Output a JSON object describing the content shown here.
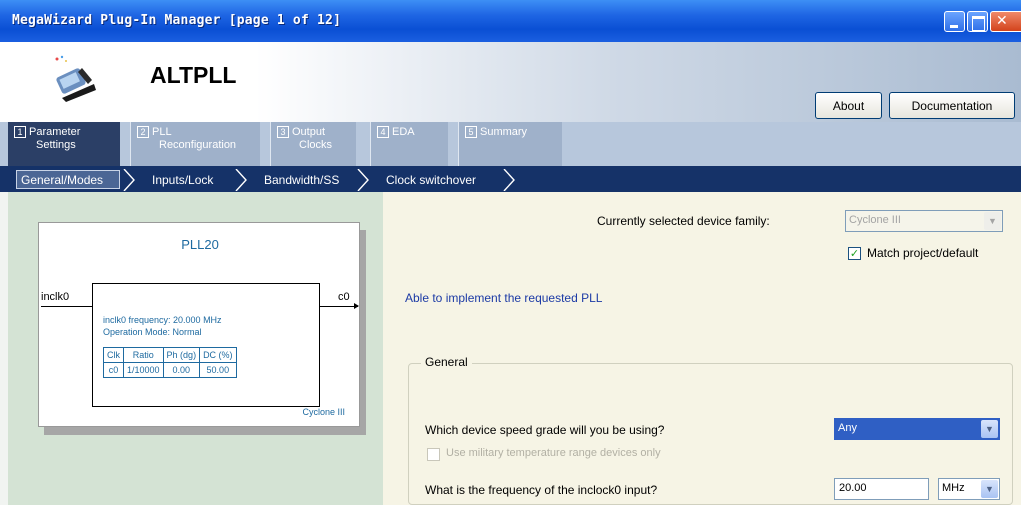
{
  "window": {
    "title": "MegaWizard Plug-In Manager [page 1 of 12]"
  },
  "header": {
    "app_name": "ALTPLL",
    "about_label": "About",
    "documentation_label": "Documentation"
  },
  "tabs": [
    {
      "num": "1",
      "line1": "Parameter",
      "line2": "Settings"
    },
    {
      "num": "2",
      "line1": "PLL",
      "line2": "Reconfiguration"
    },
    {
      "num": "3",
      "line1": "Output",
      "line2": "Clocks"
    },
    {
      "num": "4",
      "line1": "EDA",
      "line2": ""
    },
    {
      "num": "5",
      "line1": "Summary",
      "line2": ""
    }
  ],
  "subtabs": [
    "General/Modes",
    "Inputs/Lock",
    "Bandwidth/SS",
    "Clock switchover"
  ],
  "diagram": {
    "title": "PLL20",
    "input_port": "inclk0",
    "output_port": "c0",
    "frequency_line": "inclk0 frequency: 20.000 MHz",
    "mode_line": "Operation Mode: Normal",
    "table_headers": [
      "Clk",
      "Ratio",
      "Ph (dg)",
      "DC (%)"
    ],
    "table_rows": [
      [
        "c0",
        "1/10000",
        "0.00",
        "50.00"
      ]
    ],
    "family": "Cyclone III"
  },
  "settings": {
    "device_family_label": "Currently selected device family:",
    "device_family_value": "Cyclone III",
    "match_project_label": "Match project/default",
    "status_message": "Able to implement the requested PLL",
    "group_title": "General",
    "speed_grade_question": "Which device speed grade will you be using?",
    "speed_grade_value": "Any",
    "military_label": "Use military temperature range devices only",
    "frequency_question": "What is the frequency of the inclock0 input?",
    "frequency_value": "20.00",
    "frequency_unit": "MHz"
  }
}
